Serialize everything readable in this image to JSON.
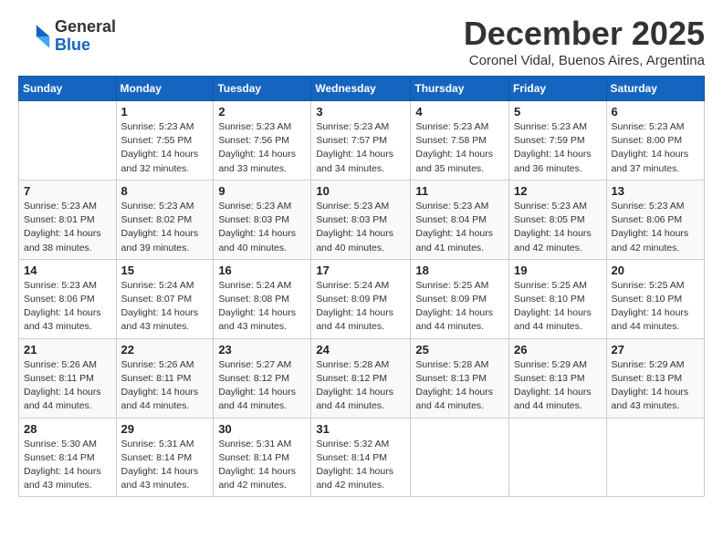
{
  "logo": {
    "general": "General",
    "blue": "Blue"
  },
  "title": "December 2025",
  "subtitle": "Coronel Vidal, Buenos Aires, Argentina",
  "days_header": [
    "Sunday",
    "Monday",
    "Tuesday",
    "Wednesday",
    "Thursday",
    "Friday",
    "Saturday"
  ],
  "weeks": [
    [
      {
        "day": "",
        "info": ""
      },
      {
        "day": "1",
        "info": "Sunrise: 5:23 AM\nSunset: 7:55 PM\nDaylight: 14 hours\nand 32 minutes."
      },
      {
        "day": "2",
        "info": "Sunrise: 5:23 AM\nSunset: 7:56 PM\nDaylight: 14 hours\nand 33 minutes."
      },
      {
        "day": "3",
        "info": "Sunrise: 5:23 AM\nSunset: 7:57 PM\nDaylight: 14 hours\nand 34 minutes."
      },
      {
        "day": "4",
        "info": "Sunrise: 5:23 AM\nSunset: 7:58 PM\nDaylight: 14 hours\nand 35 minutes."
      },
      {
        "day": "5",
        "info": "Sunrise: 5:23 AM\nSunset: 7:59 PM\nDaylight: 14 hours\nand 36 minutes."
      },
      {
        "day": "6",
        "info": "Sunrise: 5:23 AM\nSunset: 8:00 PM\nDaylight: 14 hours\nand 37 minutes."
      }
    ],
    [
      {
        "day": "7",
        "info": "Sunrise: 5:23 AM\nSunset: 8:01 PM\nDaylight: 14 hours\nand 38 minutes."
      },
      {
        "day": "8",
        "info": "Sunrise: 5:23 AM\nSunset: 8:02 PM\nDaylight: 14 hours\nand 39 minutes."
      },
      {
        "day": "9",
        "info": "Sunrise: 5:23 AM\nSunset: 8:03 PM\nDaylight: 14 hours\nand 40 minutes."
      },
      {
        "day": "10",
        "info": "Sunrise: 5:23 AM\nSunset: 8:03 PM\nDaylight: 14 hours\nand 40 minutes."
      },
      {
        "day": "11",
        "info": "Sunrise: 5:23 AM\nSunset: 8:04 PM\nDaylight: 14 hours\nand 41 minutes."
      },
      {
        "day": "12",
        "info": "Sunrise: 5:23 AM\nSunset: 8:05 PM\nDaylight: 14 hours\nand 42 minutes."
      },
      {
        "day": "13",
        "info": "Sunrise: 5:23 AM\nSunset: 8:06 PM\nDaylight: 14 hours\nand 42 minutes."
      }
    ],
    [
      {
        "day": "14",
        "info": "Sunrise: 5:23 AM\nSunset: 8:06 PM\nDaylight: 14 hours\nand 43 minutes."
      },
      {
        "day": "15",
        "info": "Sunrise: 5:24 AM\nSunset: 8:07 PM\nDaylight: 14 hours\nand 43 minutes."
      },
      {
        "day": "16",
        "info": "Sunrise: 5:24 AM\nSunset: 8:08 PM\nDaylight: 14 hours\nand 43 minutes."
      },
      {
        "day": "17",
        "info": "Sunrise: 5:24 AM\nSunset: 8:09 PM\nDaylight: 14 hours\nand 44 minutes."
      },
      {
        "day": "18",
        "info": "Sunrise: 5:25 AM\nSunset: 8:09 PM\nDaylight: 14 hours\nand 44 minutes."
      },
      {
        "day": "19",
        "info": "Sunrise: 5:25 AM\nSunset: 8:10 PM\nDaylight: 14 hours\nand 44 minutes."
      },
      {
        "day": "20",
        "info": "Sunrise: 5:25 AM\nSunset: 8:10 PM\nDaylight: 14 hours\nand 44 minutes."
      }
    ],
    [
      {
        "day": "21",
        "info": "Sunrise: 5:26 AM\nSunset: 8:11 PM\nDaylight: 14 hours\nand 44 minutes."
      },
      {
        "day": "22",
        "info": "Sunrise: 5:26 AM\nSunset: 8:11 PM\nDaylight: 14 hours\nand 44 minutes."
      },
      {
        "day": "23",
        "info": "Sunrise: 5:27 AM\nSunset: 8:12 PM\nDaylight: 14 hours\nand 44 minutes."
      },
      {
        "day": "24",
        "info": "Sunrise: 5:28 AM\nSunset: 8:12 PM\nDaylight: 14 hours\nand 44 minutes."
      },
      {
        "day": "25",
        "info": "Sunrise: 5:28 AM\nSunset: 8:13 PM\nDaylight: 14 hours\nand 44 minutes."
      },
      {
        "day": "26",
        "info": "Sunrise: 5:29 AM\nSunset: 8:13 PM\nDaylight: 14 hours\nand 44 minutes."
      },
      {
        "day": "27",
        "info": "Sunrise: 5:29 AM\nSunset: 8:13 PM\nDaylight: 14 hours\nand 43 minutes."
      }
    ],
    [
      {
        "day": "28",
        "info": "Sunrise: 5:30 AM\nSunset: 8:14 PM\nDaylight: 14 hours\nand 43 minutes."
      },
      {
        "day": "29",
        "info": "Sunrise: 5:31 AM\nSunset: 8:14 PM\nDaylight: 14 hours\nand 43 minutes."
      },
      {
        "day": "30",
        "info": "Sunrise: 5:31 AM\nSunset: 8:14 PM\nDaylight: 14 hours\nand 42 minutes."
      },
      {
        "day": "31",
        "info": "Sunrise: 5:32 AM\nSunset: 8:14 PM\nDaylight: 14 hours\nand 42 minutes."
      },
      {
        "day": "",
        "info": ""
      },
      {
        "day": "",
        "info": ""
      },
      {
        "day": "",
        "info": ""
      }
    ]
  ]
}
